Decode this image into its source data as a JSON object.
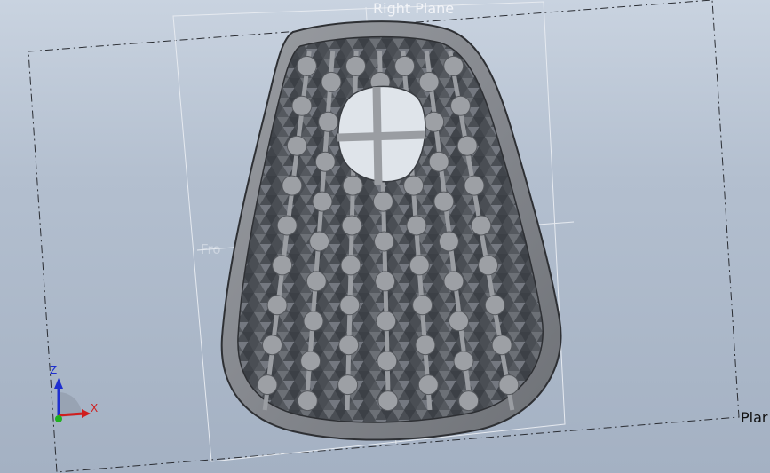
{
  "planes": {
    "right": "Right Plane",
    "front": "Fro",
    "top": "Plar"
  },
  "triad": {
    "z_label": "Z",
    "x_label": "X",
    "colors": {
      "x": "#d01e1e",
      "y": "#20b020",
      "z": "#1e2fd0"
    }
  },
  "model": {
    "rows": 9,
    "columns": 7,
    "colors": {
      "frame": "#8c8f94",
      "lattice": "#5f6369",
      "rib": "#9a9da2",
      "edge": "#2e3034"
    }
  },
  "viewport_colors": {
    "bg_top": "#c9d3e0",
    "bg_bottom": "#a4b1c3"
  }
}
